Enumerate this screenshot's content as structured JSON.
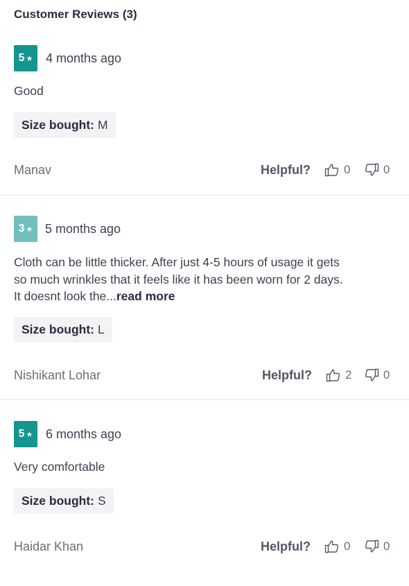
{
  "heading": "Customer Reviews (3)",
  "helpful_label": "Helpful?",
  "size_label": "Size bought:",
  "colors": {
    "rating_5": "#14958f",
    "rating_3": "#72bfbc",
    "chip_bg": "#f3f3f5",
    "divider": "#e9e9eb"
  },
  "icons": {
    "star": "star-icon",
    "thumbs_up": "thumbs-up-icon",
    "thumbs_down": "thumbs-down-icon"
  },
  "reviews": [
    {
      "rating": "5",
      "date": "4 months ago",
      "text": "Good",
      "size": "M",
      "author": "Manav",
      "upvotes": "0",
      "downvotes": "0"
    },
    {
      "rating": "3",
      "date": "5 months ago",
      "text_lines": [
        "Cloth can be little thicker. After just 4-5 hours of usage it gets",
        "so much wrinkles that it feels like it has been worn for 2 days.",
        "It doesnt look the..."
      ],
      "read_more": "read more",
      "size": "L",
      "author": "Nishikant Lohar",
      "upvotes": "2",
      "downvotes": "0"
    },
    {
      "rating": "5",
      "date": "6 months ago",
      "text": "Very comfortable",
      "size": "S",
      "author": "Haidar Khan",
      "upvotes": "0",
      "downvotes": "0"
    }
  ]
}
